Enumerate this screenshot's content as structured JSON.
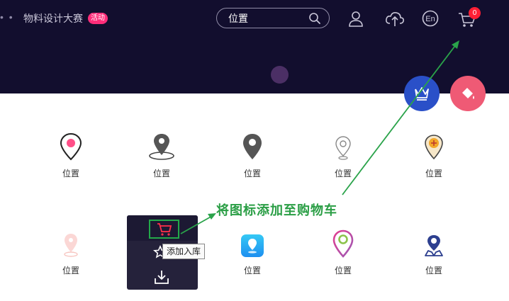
{
  "header": {
    "dots": "• •",
    "brand": "物料设计大赛",
    "badge": "活动",
    "search_placeholder": "位置",
    "cart_count": "0"
  },
  "grid": {
    "row1": [
      {
        "label": "位置",
        "icon": "pin-pink-icon"
      },
      {
        "label": "位置",
        "icon": "pin-ground-icon"
      },
      {
        "label": "位置",
        "icon": "pin-solid-gray-icon"
      },
      {
        "label": "位置",
        "icon": "pin-outline-icon"
      },
      {
        "label": "位置",
        "icon": "pin-plus-icon"
      }
    ],
    "row2": [
      {
        "label": "位置",
        "icon": "pin-faded-icon"
      },
      {
        "label": "",
        "icon": "hover-card"
      },
      {
        "label": "位置",
        "icon": "app-pin-icon"
      },
      {
        "label": "位置",
        "icon": "pin-gradient-icon"
      },
      {
        "label": "位置",
        "icon": "pin-person-icon"
      }
    ]
  },
  "hover_card": {
    "tooltip": "添加入库"
  },
  "annotation": {
    "text": "将图标添加至购物车"
  },
  "colors": {
    "header_bg": "#120e2e",
    "accent_green": "#23a84a",
    "badge_pink": "#ff2d7a",
    "fab_blue": "#2a50c8",
    "fab_pink": "#ef5a75"
  }
}
